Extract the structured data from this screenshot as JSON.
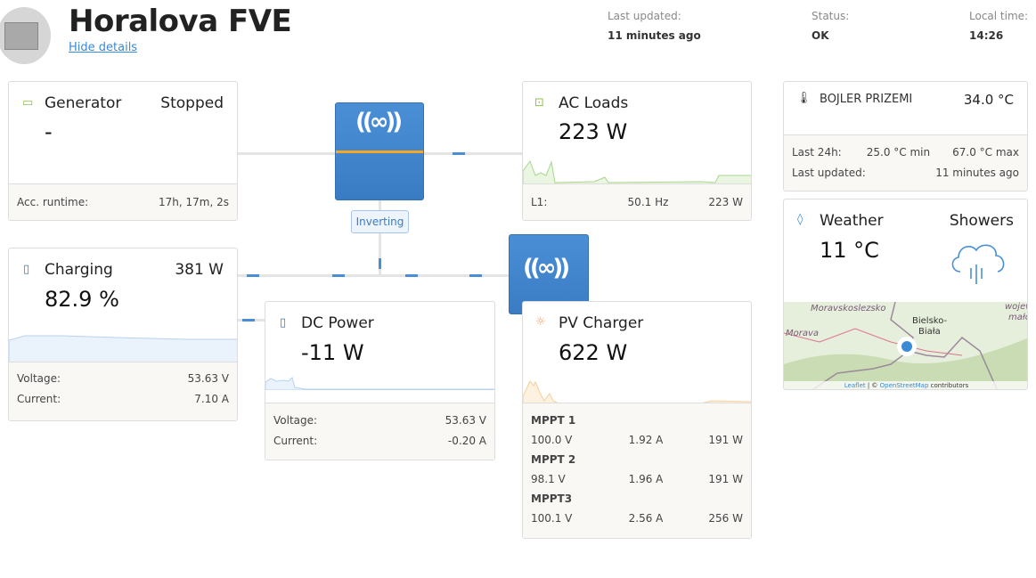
{
  "header": {
    "title": "Horalova FVE",
    "hide_details": "Hide details",
    "last_updated_label": "Last updated:",
    "last_updated_value": "11 minutes ago",
    "status_label": "Status:",
    "status_value": "OK",
    "local_time_label": "Local time:",
    "local_time_value": "14:26"
  },
  "generator": {
    "title": "Generator",
    "state": "Stopped",
    "value": "-",
    "runtime_label": "Acc. runtime:",
    "runtime_value": "17h, 17m, 2s"
  },
  "inverter": {
    "badge": "Inverting"
  },
  "ac_loads": {
    "title": "AC Loads",
    "value": "223 W",
    "l1_label": "L1:",
    "l1_freq": "50.1 Hz",
    "l1_power": "223 W"
  },
  "battery": {
    "title": "Charging",
    "power": "381 W",
    "soc": "82.9 %",
    "voltage_label": "Voltage:",
    "voltage": "53.63 V",
    "current_label": "Current:",
    "current": "7.10 A"
  },
  "dc_power": {
    "title": "DC Power",
    "value": "-11 W",
    "voltage_label": "Voltage:",
    "voltage": "53.63 V",
    "current_label": "Current:",
    "current": "-0.20 A"
  },
  "pv": {
    "title": "PV Charger",
    "value": "622 W",
    "mppts": [
      {
        "name": "MPPT 1",
        "voltage": "100.0 V",
        "current": "1.92 A",
        "power": "191 W"
      },
      {
        "name": "MPPT 2",
        "voltage": "98.1 V",
        "current": "1.96 A",
        "power": "191 W"
      },
      {
        "name": "MPPT3",
        "voltage": "100.1 V",
        "current": "2.56 A",
        "power": "256 W"
      }
    ]
  },
  "sensor": {
    "title": "BOJLER PRIZEMI",
    "value": "34.0 °C",
    "last24_label": "Last 24h:",
    "min": "25.0 °C min",
    "max": "67.0 °C max",
    "updated_label": "Last updated:",
    "updated": "11 minutes ago"
  },
  "weather": {
    "title": "Weather",
    "condition": "Showers",
    "temp": "11 °C",
    "map_labels": [
      "Moravskoslezsko",
      "Morava",
      "Bielsko-",
      "Biała",
      "wojew",
      "małop"
    ],
    "attribution_leaflet": "Leaflet",
    "attribution_sep": " | © ",
    "attribution_osm": "OpenStreetMap",
    "attribution_rest": " contributors"
  },
  "colors": {
    "accent": "#3a7cc4",
    "orange": "#f5a623",
    "green": "#8bc34a"
  }
}
